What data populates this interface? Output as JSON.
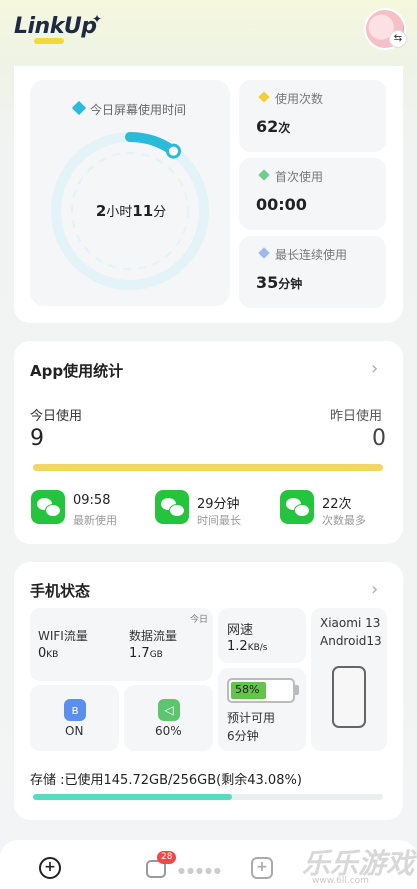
{
  "header": {
    "logo_text": "LinkUp",
    "avatar_badge_icon": "swap-icon"
  },
  "screen_time": {
    "title": "今日屏幕使用时间",
    "hours": "2",
    "hours_unit": "小时",
    "minutes": "11",
    "minutes_unit": "分",
    "progress": 0.1,
    "accent_color": "#2bbbd8"
  },
  "stats": [
    {
      "label": "使用次数",
      "value": "62",
      "unit": "次",
      "color": "#f2cf3a"
    },
    {
      "label": "首次使用",
      "value": "00:00",
      "unit": "",
      "color": "#6fd08d"
    },
    {
      "label": "最长连续使用",
      "value": "35",
      "unit": "分钟",
      "color": "#9db8ea"
    }
  ],
  "app_usage": {
    "title": "App使用统计",
    "today_label": "今日使用",
    "today_value": "9",
    "yesterday_label": "昨日使用",
    "yesterday_value": "0",
    "bar_progress": 1.0,
    "items": [
      {
        "value": "09:58",
        "label": "最新使用",
        "icon": "wechat-icon"
      },
      {
        "value": "29分钟",
        "label": "时间最长",
        "icon": "wechat-icon"
      },
      {
        "value": "22次",
        "label": "次数最多",
        "icon": "wechat-icon"
      }
    ]
  },
  "phone_status": {
    "title": "手机状态",
    "today_tag": "今日",
    "wifi_label": "WIFI流量",
    "wifi_value": "0",
    "wifi_unit": "KB",
    "data_label": "数据流量",
    "data_value": "1.7",
    "data_unit": "GB",
    "speed_label": "网速",
    "speed_value": "1.2",
    "speed_unit": "KB/s",
    "device_name": "Xiaomi 13",
    "os_version": "Android13",
    "bluetooth_icon": "bluetooth-icon",
    "bluetooth_value": "ON",
    "volume_icon": "volume-icon",
    "volume_value": "60%",
    "battery_text": "58%",
    "battery_level": 0.58,
    "remaining_label": "预计可用",
    "remaining_value": "6分钟",
    "storage_text": "存储 :已使用145.72GB/256GB(剩余43.08%)",
    "storage_used_fraction": 0.5692
  },
  "tabbar": {
    "message_badge": "28",
    "watermark": "乐乐游戏",
    "watermark_sub": "www.6ll.com"
  }
}
